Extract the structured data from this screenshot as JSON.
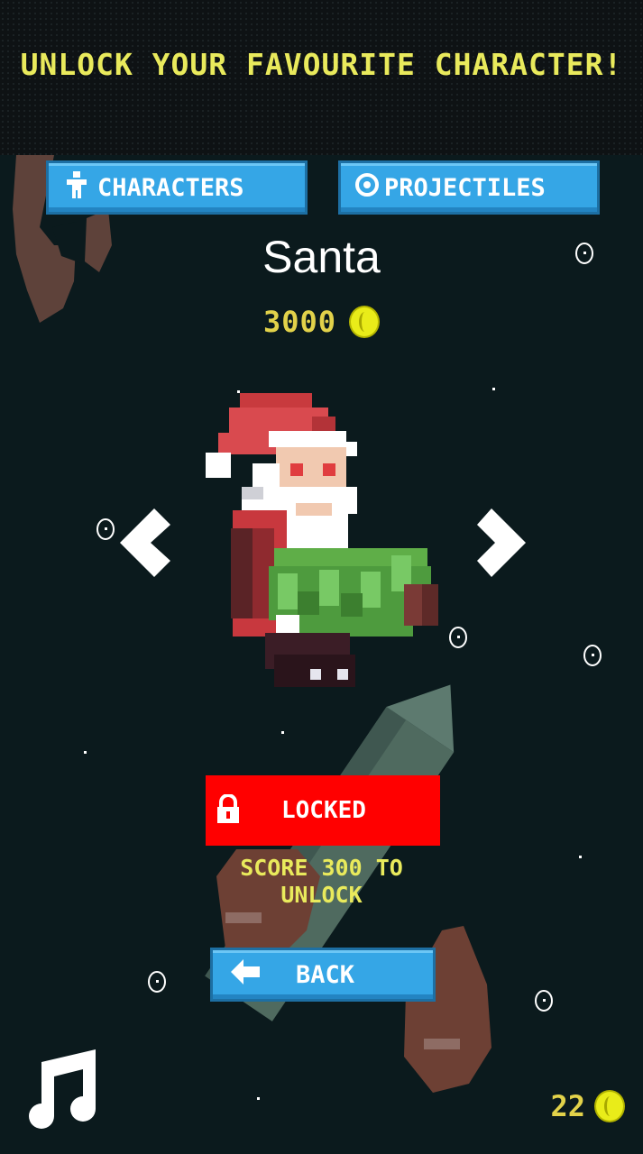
{
  "banner": {
    "title": "UNLOCK YOUR FAVOURITE CHARACTER!"
  },
  "tabs": {
    "characters_label": "CHARACTERS",
    "projectiles_label": "PROJECTILES"
  },
  "character": {
    "name": "Santa",
    "price": "3000",
    "status_label": "LOCKED",
    "unlock_line1": "SCORE 300 TO",
    "unlock_line2": "UNLOCK"
  },
  "back_label": "BACK",
  "wallet": {
    "coins": "22"
  },
  "colors": {
    "accent_button": "#35a6e6",
    "locked_red": "#ff0000",
    "text_yellow": "#e9ea5c",
    "background": "#0b1a1d"
  },
  "icons": [
    "person-icon",
    "target-icon",
    "coin-icon",
    "left-arrow-icon",
    "right-arrow-icon",
    "lock-icon",
    "back-arrow-icon",
    "music-note-icon"
  ]
}
